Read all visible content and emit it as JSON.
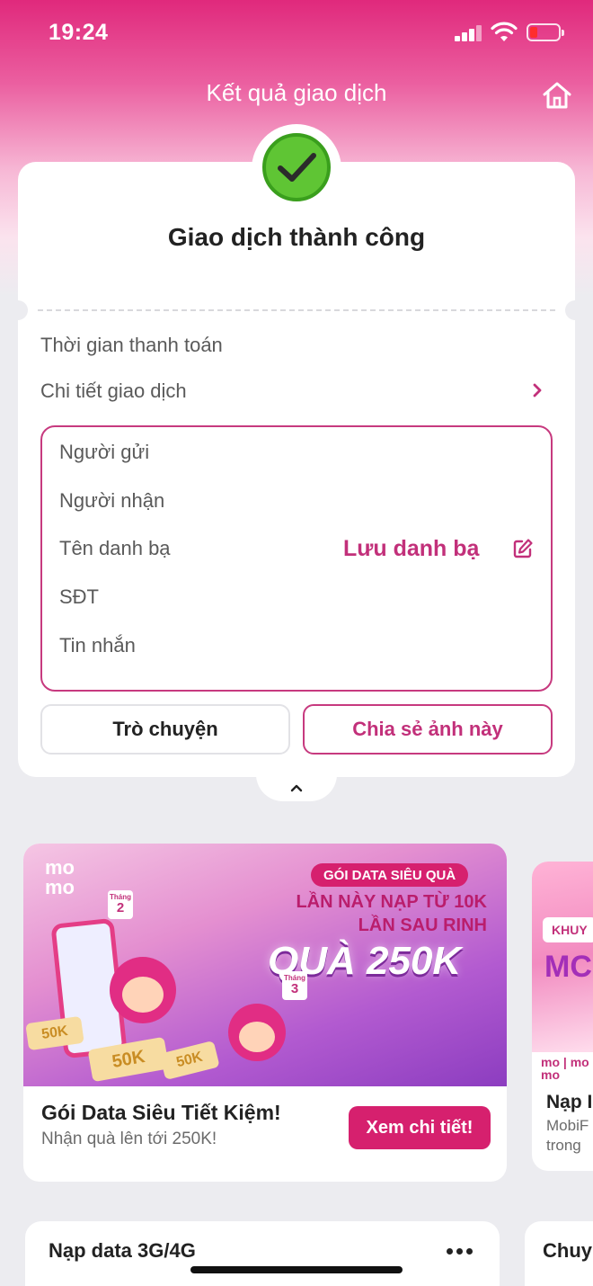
{
  "status_bar": {
    "time": "19:24"
  },
  "header": {
    "title": "Kết quả giao dịch"
  },
  "result": {
    "title": "Giao dịch thành công",
    "payment_time_label": "Thời gian thanh toán",
    "details_label": "Chi tiết giao dịch"
  },
  "details": {
    "sender_label": "Người gửi",
    "receiver_label": "Người nhận",
    "contact_name_label": "Tên danh bạ",
    "save_contact_label": "Lưu danh bạ",
    "phone_label": "SĐT",
    "message_label": "Tin nhắn"
  },
  "actions": {
    "chat_label": "Trò chuyện",
    "share_label": "Chia sẻ ảnh này"
  },
  "promo": {
    "logo_line1": "mo",
    "logo_line2": "mo",
    "pill": "GÓI DATA SIÊU QUÀ",
    "line1": "LẦN NÀY NẠP TỪ 10K",
    "line2": "LẦN SAU RINH",
    "big": "QUÀ 250K",
    "month_label": "Tháng",
    "month_a": "2",
    "month_b": "3",
    "voucher_a": "50K",
    "voucher_b": "50K",
    "voucher_c": "50K",
    "title": "Gói Data Siêu Tiết Kiệm!",
    "subtitle": "Nhận quà lên tới 250K!",
    "button": "Xem chi tiết!"
  },
  "promo2": {
    "pill": "KHUY",
    "big": "MC",
    "logo_line1": "mo",
    "logo_line2": "mo",
    "logo_partner": "mo",
    "title": "Nạp I",
    "subtitle_line1": "MobiF",
    "subtitle_line2": "trong"
  },
  "bottom": {
    "card1_title": "Nạp data 3G/4G",
    "card2_title": "Chuy"
  },
  "colors": {
    "brand": "#d6206e",
    "accent_text": "#c2307a",
    "success": "#5fc534"
  }
}
